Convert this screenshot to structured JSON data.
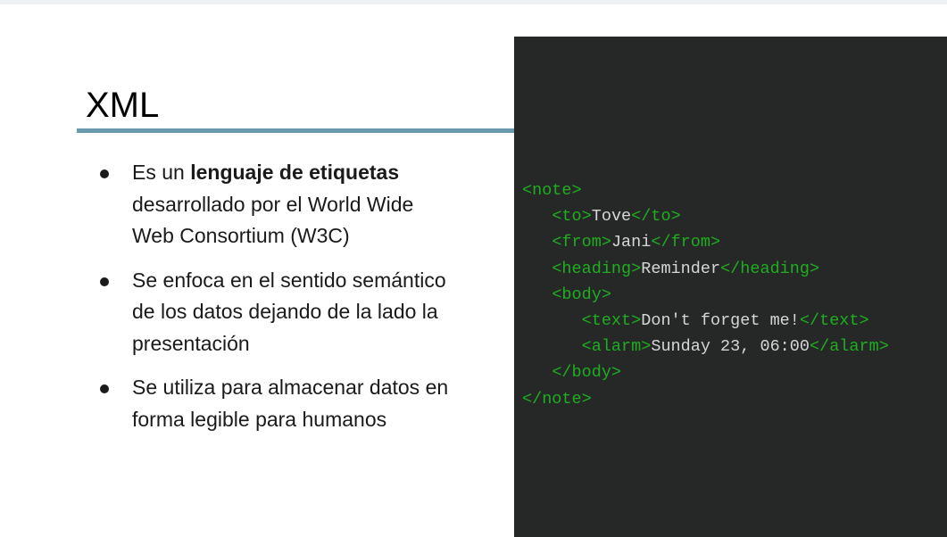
{
  "slide": {
    "title": "XML",
    "bullets": [
      {
        "bold": "lenguaje de etiquetas",
        "lines": [
          "Es un ",
          "desarrollado por el World Wide",
          "Web Consortium (W3C)"
        ]
      },
      {
        "lines": [
          "Se enfoca en el sentido semántico",
          "de los datos dejando de la lado la",
          "presentación"
        ]
      },
      {
        "lines": [
          "Se utiliza para almacenar datos en",
          "forma legible para humanos"
        ]
      }
    ]
  },
  "code": {
    "lines": [
      {
        "indent": "",
        "open": "<note>",
        "text": "",
        "close": ""
      },
      {
        "indent": "   ",
        "open": "<to>",
        "text": "Tove",
        "close": "</to>"
      },
      {
        "indent": "   ",
        "open": "<from>",
        "text": "Jani",
        "close": "</from>"
      },
      {
        "indent": "   ",
        "open": "<heading>",
        "text": "Reminder",
        "close": "</heading>"
      },
      {
        "indent": "   ",
        "open": "<body>",
        "text": "",
        "close": ""
      },
      {
        "indent": "      ",
        "open": "<text>",
        "text": "Don't forget me!",
        "close": "</text>"
      },
      {
        "indent": "      ",
        "open": "<alarm>",
        "text": "Sunday 23, 06:00",
        "close": "</alarm>"
      },
      {
        "indent": "   ",
        "open": "</body>",
        "text": "",
        "close": ""
      },
      {
        "indent": "",
        "open": "</note>",
        "text": "",
        "close": ""
      }
    ]
  },
  "colors": {
    "title_rule": "#6a9ab0",
    "code_background": "#262828",
    "code_tag": "#1fae1f",
    "code_text": "#d6d6d6"
  }
}
